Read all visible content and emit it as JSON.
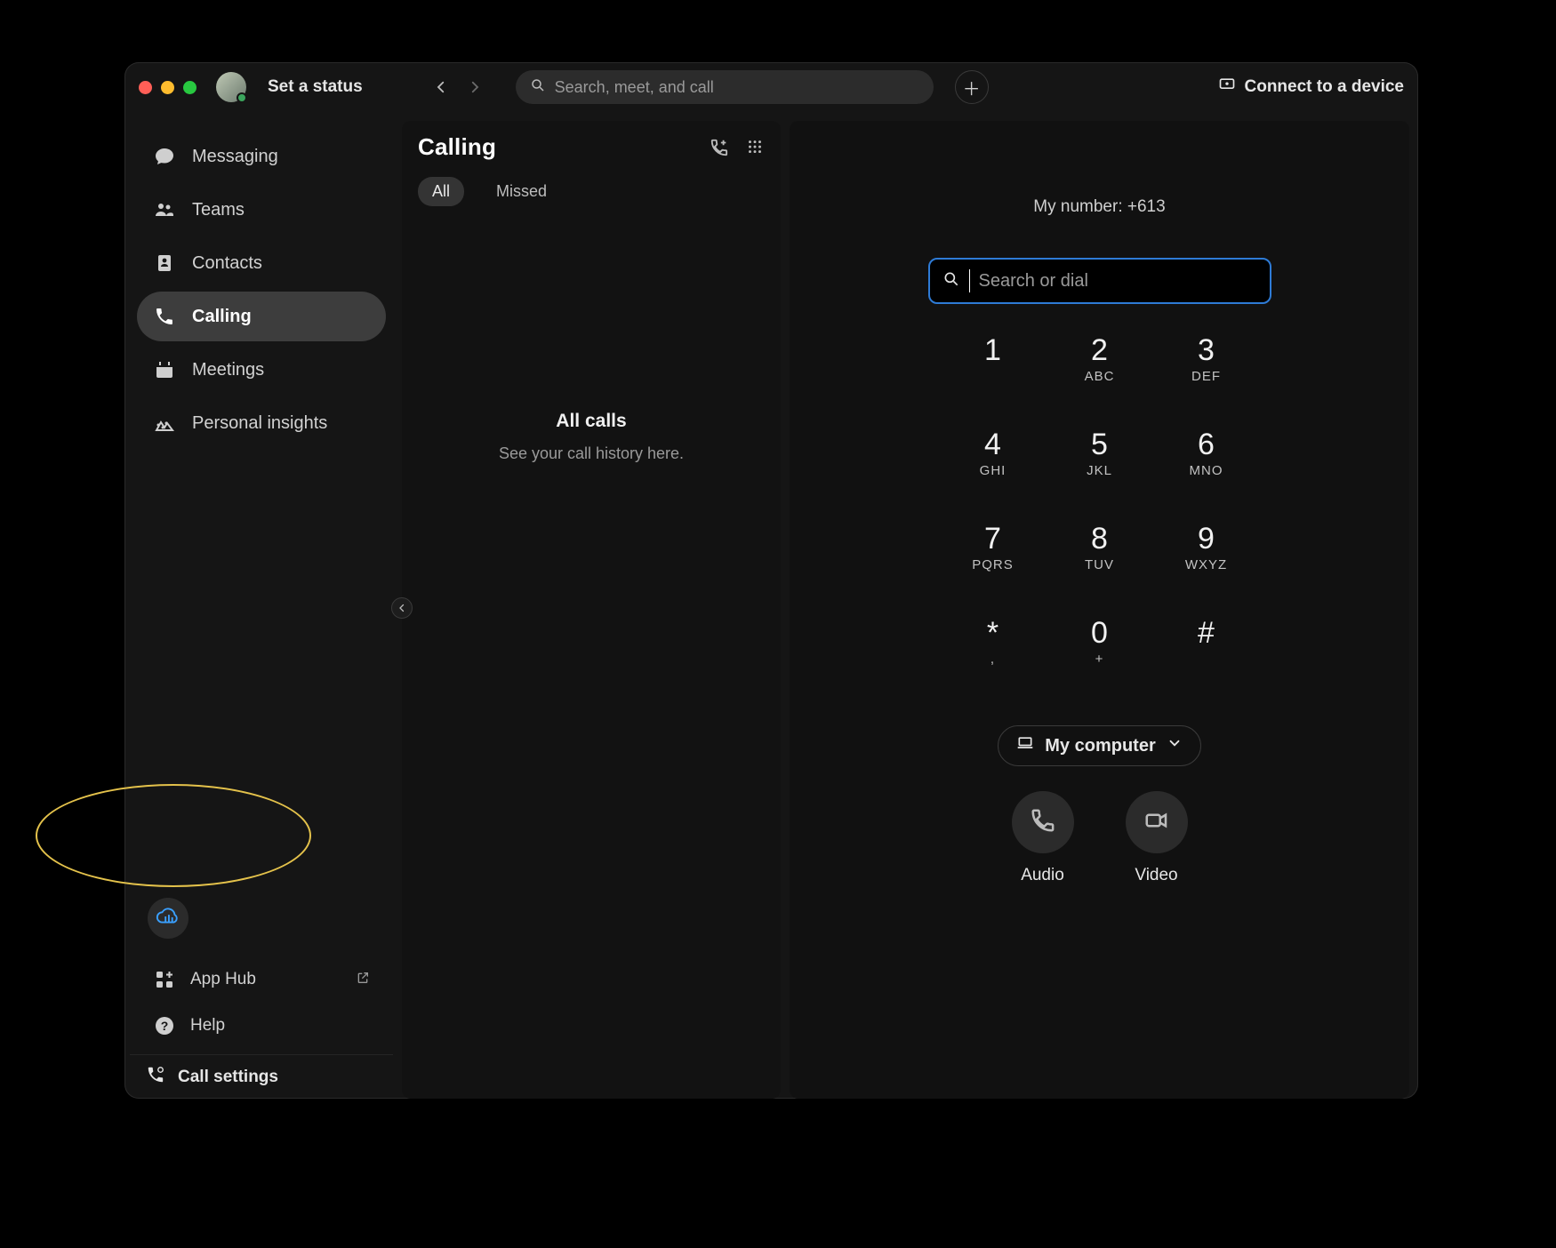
{
  "header": {
    "status_label": "Set a status",
    "search_placeholder": "Search, meet, and call",
    "connect_device_label": "Connect to a device"
  },
  "sidebar": {
    "items": [
      {
        "label": "Messaging"
      },
      {
        "label": "Teams"
      },
      {
        "label": "Contacts"
      },
      {
        "label": "Calling"
      },
      {
        "label": "Meetings"
      },
      {
        "label": "Personal insights"
      }
    ],
    "bottom_links": [
      {
        "label": "App Hub"
      },
      {
        "label": "Help"
      }
    ],
    "settings_label": "Call settings"
  },
  "calling_panel": {
    "title": "Calling",
    "tabs": [
      {
        "label": "All",
        "active": true
      },
      {
        "label": "Missed",
        "active": false
      }
    ],
    "empty_title": "All calls",
    "empty_sub": "See your call history here."
  },
  "dialer": {
    "my_number_label": "My number: +613",
    "input_placeholder": "Search or dial",
    "device_label": "My computer",
    "call_audio_label": "Audio",
    "call_video_label": "Video",
    "keys": [
      {
        "digit": "1",
        "letters": ""
      },
      {
        "digit": "2",
        "letters": "ABC"
      },
      {
        "digit": "3",
        "letters": "DEF"
      },
      {
        "digit": "4",
        "letters": "GHI"
      },
      {
        "digit": "5",
        "letters": "JKL"
      },
      {
        "digit": "6",
        "letters": "MNO"
      },
      {
        "digit": "7",
        "letters": "PQRS"
      },
      {
        "digit": "8",
        "letters": "TUV"
      },
      {
        "digit": "9",
        "letters": "WXYZ"
      },
      {
        "digit": "*",
        "letters": ","
      },
      {
        "digit": "0",
        "letters": "+"
      },
      {
        "digit": "#",
        "letters": ""
      }
    ]
  },
  "colors": {
    "accent": "#2e7bd6",
    "highlight": "#e4c24b"
  }
}
